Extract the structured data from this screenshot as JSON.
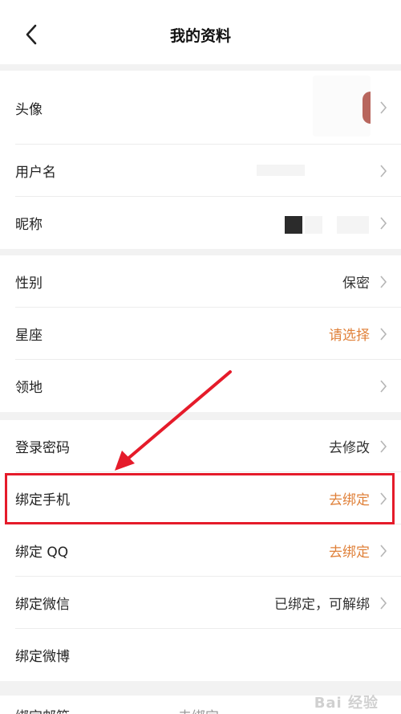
{
  "header": {
    "title": "我的资料"
  },
  "rows": {
    "avatar": {
      "label": "头像"
    },
    "username": {
      "label": "用户名"
    },
    "nickname": {
      "label": "昵称"
    },
    "gender": {
      "label": "性别",
      "value": "保密"
    },
    "zodiac": {
      "label": "星座",
      "value": "请选择"
    },
    "territory": {
      "label": "领地"
    },
    "password": {
      "label": "登录密码",
      "value": "去修改"
    },
    "phone": {
      "label": "绑定手机",
      "value": "去绑定"
    },
    "qq": {
      "label": "绑定 QQ",
      "value": "去绑定"
    },
    "wechat": {
      "label": "绑定微信",
      "value": "已绑定，可解绑"
    },
    "weibo": {
      "label": "绑定微博"
    },
    "email": {
      "label": "绑定邮箱",
      "value": "去绑定"
    }
  },
  "watermark": {
    "text": "Bai 经验"
  },
  "colors": {
    "accent": "#e0813a",
    "highlight": "#e51b2a"
  }
}
